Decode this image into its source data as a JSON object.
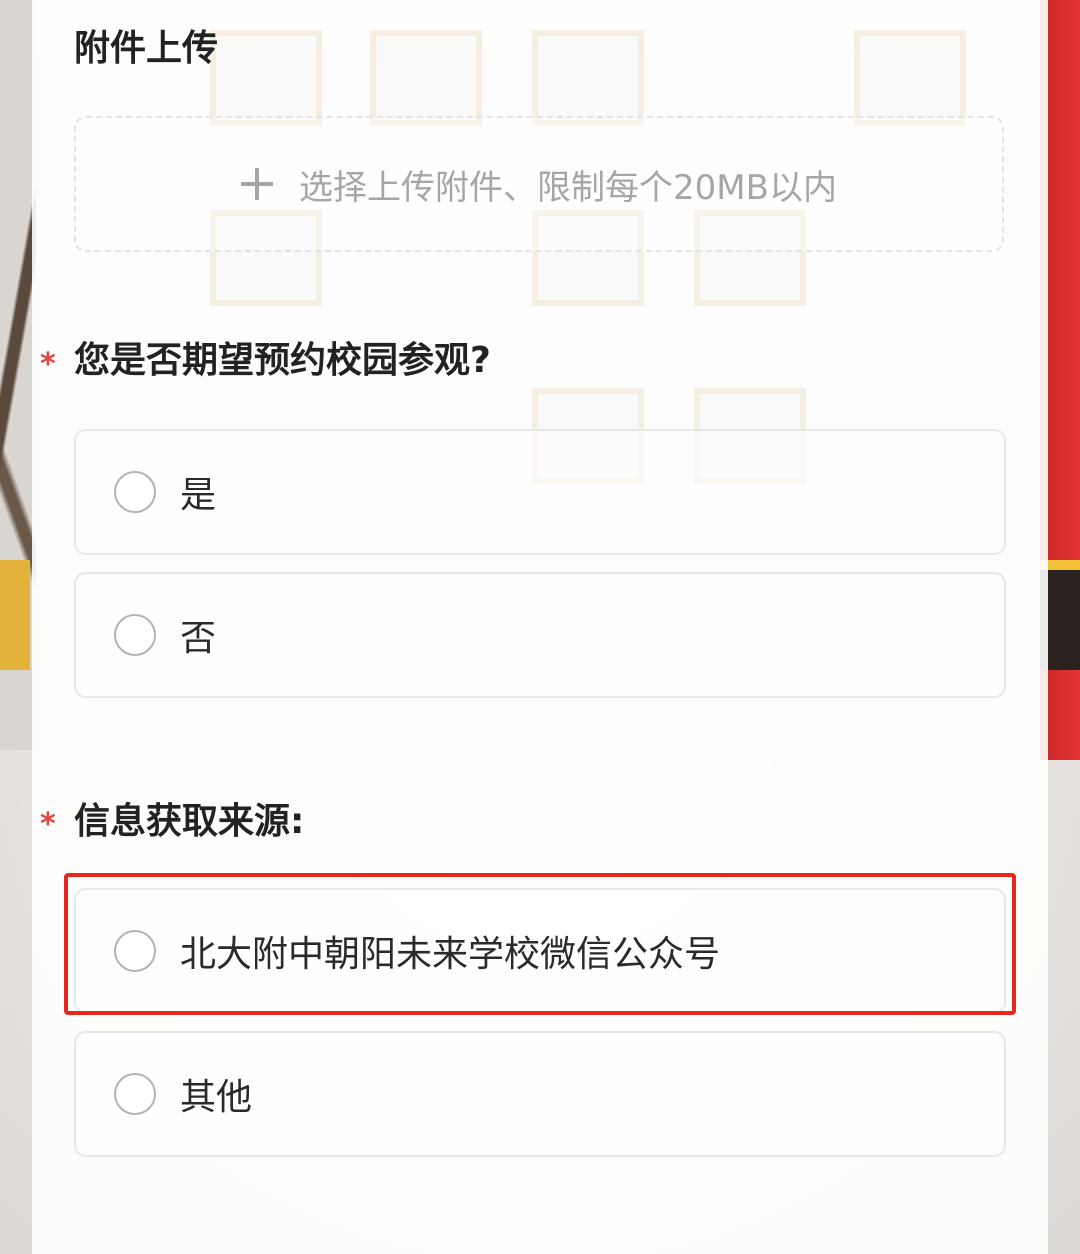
{
  "upload_section": {
    "title": "附件上传",
    "button_label": "选择上传附件、限制每个20MB以内",
    "icon": "plus-icon"
  },
  "visit_question": {
    "required_mark": "*",
    "title": "您是否期望预约校园参观?",
    "options": [
      {
        "label": "是"
      },
      {
        "label": "否"
      }
    ]
  },
  "source_question": {
    "required_mark": "*",
    "title": "信息获取来源:",
    "options": [
      {
        "label": "北大附中朝阳未来学校微信公众号"
      },
      {
        "label": "其他"
      }
    ]
  },
  "colors": {
    "required_mark": "#e0443f",
    "highlight_border": "#e8271f",
    "muted_text": "#a6a6a6"
  }
}
